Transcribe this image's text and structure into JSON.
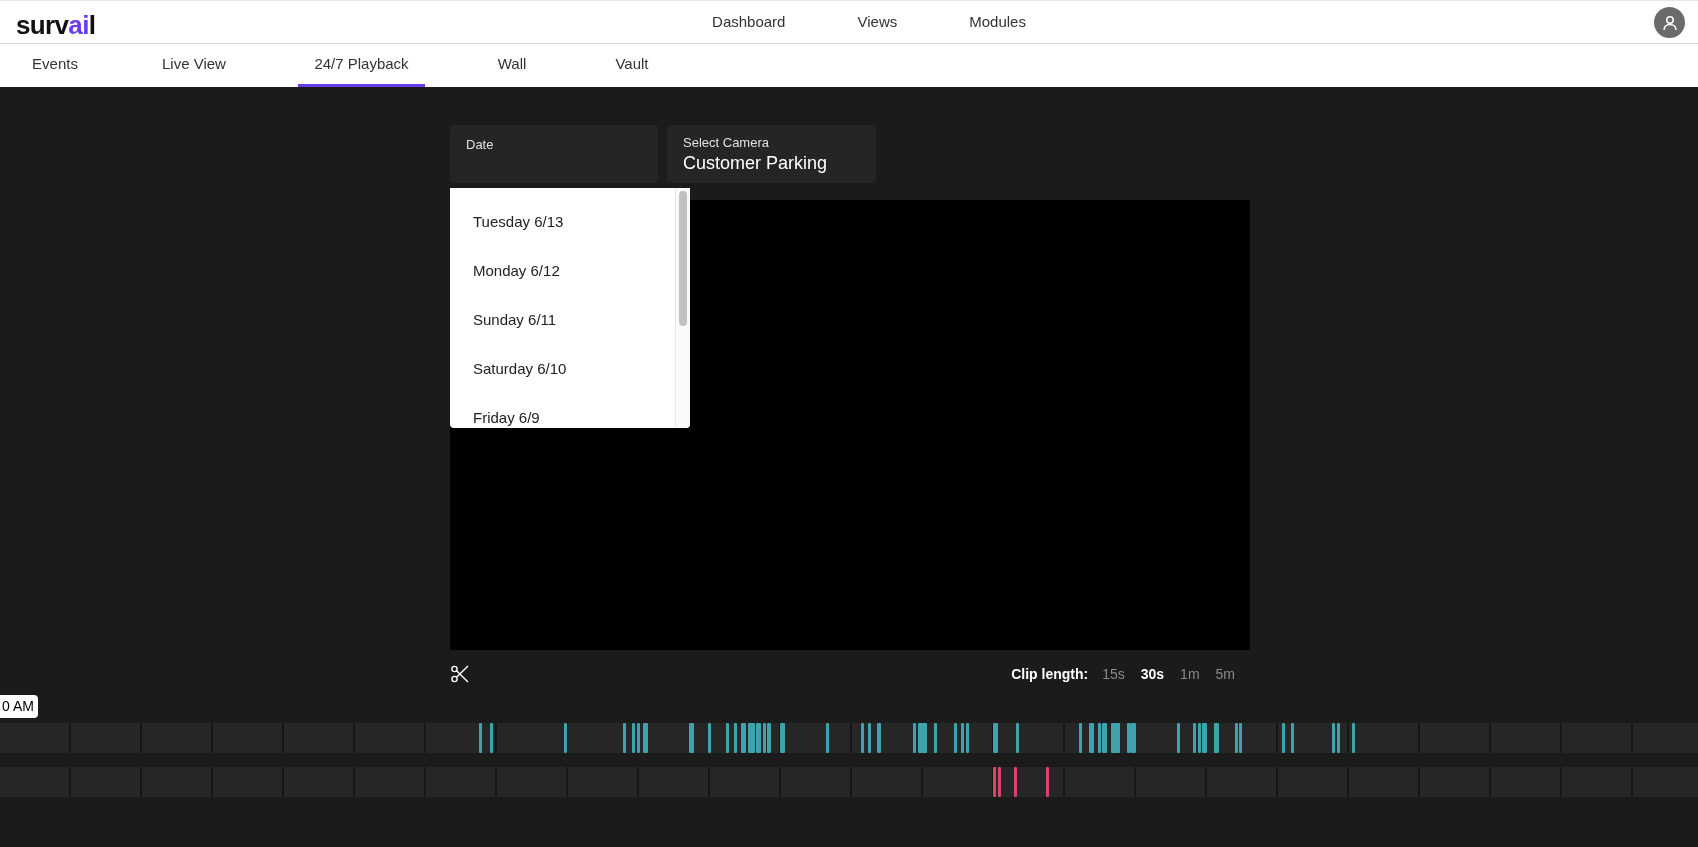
{
  "logo": [
    {
      "text": "surv",
      "accent": false
    },
    {
      "text": "ai",
      "accent": true
    },
    {
      "text": "l",
      "accent": false
    }
  ],
  "top_nav": [
    "Dashboard",
    "Views",
    "Modules"
  ],
  "tabs": [
    {
      "label": "Events",
      "selected": false
    },
    {
      "label": "Live View",
      "selected": false
    },
    {
      "label": "24/7 Playback",
      "selected": true
    },
    {
      "label": "Wall",
      "selected": false
    },
    {
      "label": "Vault",
      "selected": false
    }
  ],
  "date_field": {
    "label": "Date"
  },
  "camera_field": {
    "label": "Select Camera",
    "value": "Customer Parking"
  },
  "date_options": [
    "Tuesday 6/13",
    "Monday 6/12",
    "Sunday 6/11",
    "Saturday 6/10",
    "Friday 6/9"
  ],
  "clip_length": {
    "label": "Clip length:",
    "options": [
      {
        "label": "15s",
        "selected": false
      },
      {
        "label": "30s",
        "selected": true
      },
      {
        "label": "1m",
        "selected": false
      },
      {
        "label": "5m",
        "selected": false
      }
    ]
  },
  "timeline": {
    "time_label": "0 AM",
    "tracks": [
      {
        "color": "#3fa3ad"
      },
      {
        "color": "#d9456b"
      }
    ]
  }
}
